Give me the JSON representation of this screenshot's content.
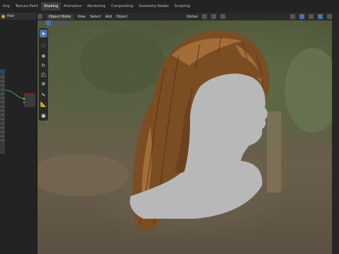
{
  "workspace_tabs": [
    {
      "label": "ting",
      "active": false
    },
    {
      "label": "Texture Paint",
      "active": false
    },
    {
      "label": "Shading",
      "active": true
    },
    {
      "label": "Animation",
      "active": false
    },
    {
      "label": "Rendering",
      "active": false
    },
    {
      "label": "Compositing",
      "active": false
    },
    {
      "label": "Geometry Nodes",
      "active": false
    },
    {
      "label": "Scripting",
      "active": false
    }
  ],
  "left_panel": {
    "header_label": "Hair"
  },
  "viewport": {
    "mode_label": "Object Mode",
    "menus": [
      "View",
      "Select",
      "Add",
      "Object"
    ],
    "transform_orientation": "Global"
  },
  "colors": {
    "accent": "#4772b3",
    "node_link": "#3fae45",
    "hair": "#7a4d23",
    "mannequin": "#b8b8b8"
  },
  "icons": [
    "cursor-icon",
    "select-box-icon",
    "move-icon",
    "rotate-icon",
    "scale-icon",
    "transform-icon",
    "annotate-icon",
    "measure-icon",
    "add-cube-icon"
  ]
}
